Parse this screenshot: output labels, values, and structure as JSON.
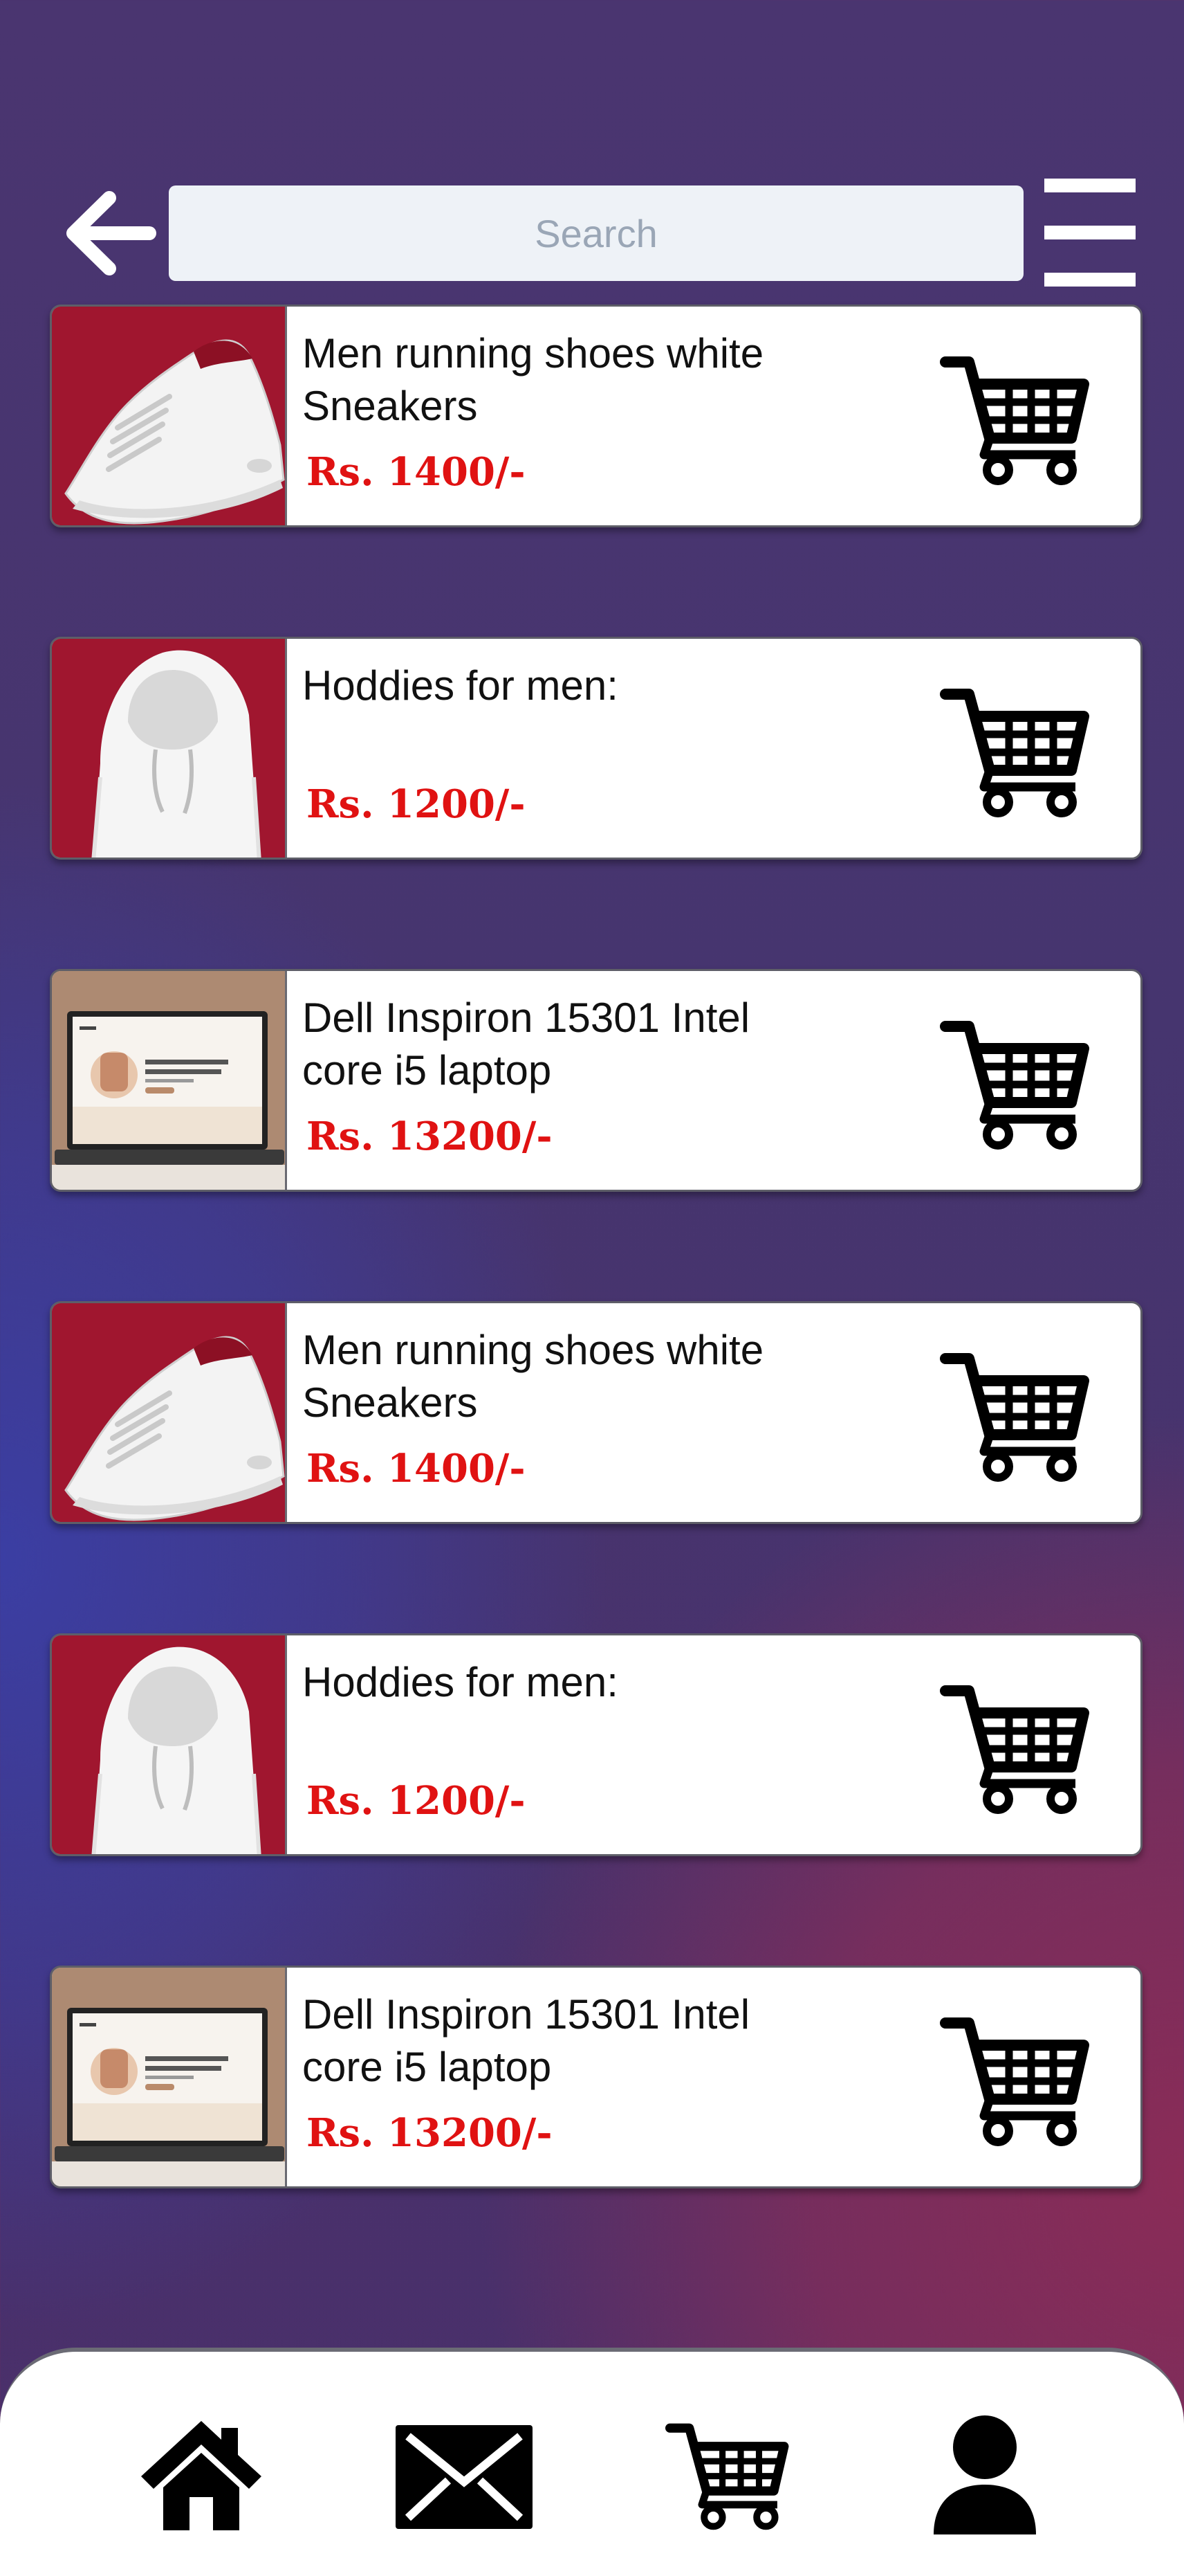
{
  "search": {
    "placeholder": "Search",
    "value": ""
  },
  "icons": {
    "back": "arrow-left-icon",
    "menu": "hamburger-menu-icon",
    "cart": "shopping-cart-icon",
    "home": "home-icon",
    "mail": "envelope-icon",
    "profile": "user-icon"
  },
  "colors": {
    "price": "#e01212",
    "card_bg": "#ffffff",
    "search_bg": "#eef2f7"
  },
  "products": [
    {
      "title": "Men running shoes white Sneakers",
      "price": "Rs. 1400/-",
      "image": "white-sneaker"
    },
    {
      "title": "Hoddies for men:",
      "price": "Rs. 1200/-",
      "image": "white-hoodie"
    },
    {
      "title": "Dell Inspiron 15301 Intel core i5 laptop",
      "price": "Rs. 13200/-",
      "image": "laptop"
    },
    {
      "title": "Men running shoes white Sneakers",
      "price": "Rs. 1400/-",
      "image": "white-sneaker"
    },
    {
      "title": "Hoddies for men:",
      "price": "Rs. 1200/-",
      "image": "white-hoodie"
    },
    {
      "title": "Dell Inspiron 15301 Intel core i5 laptop",
      "price": "Rs. 13200/-",
      "image": "laptop"
    }
  ],
  "laptop_screen": {
    "heading": "Everything You Need to Sell Courses",
    "cta": "Get started"
  }
}
